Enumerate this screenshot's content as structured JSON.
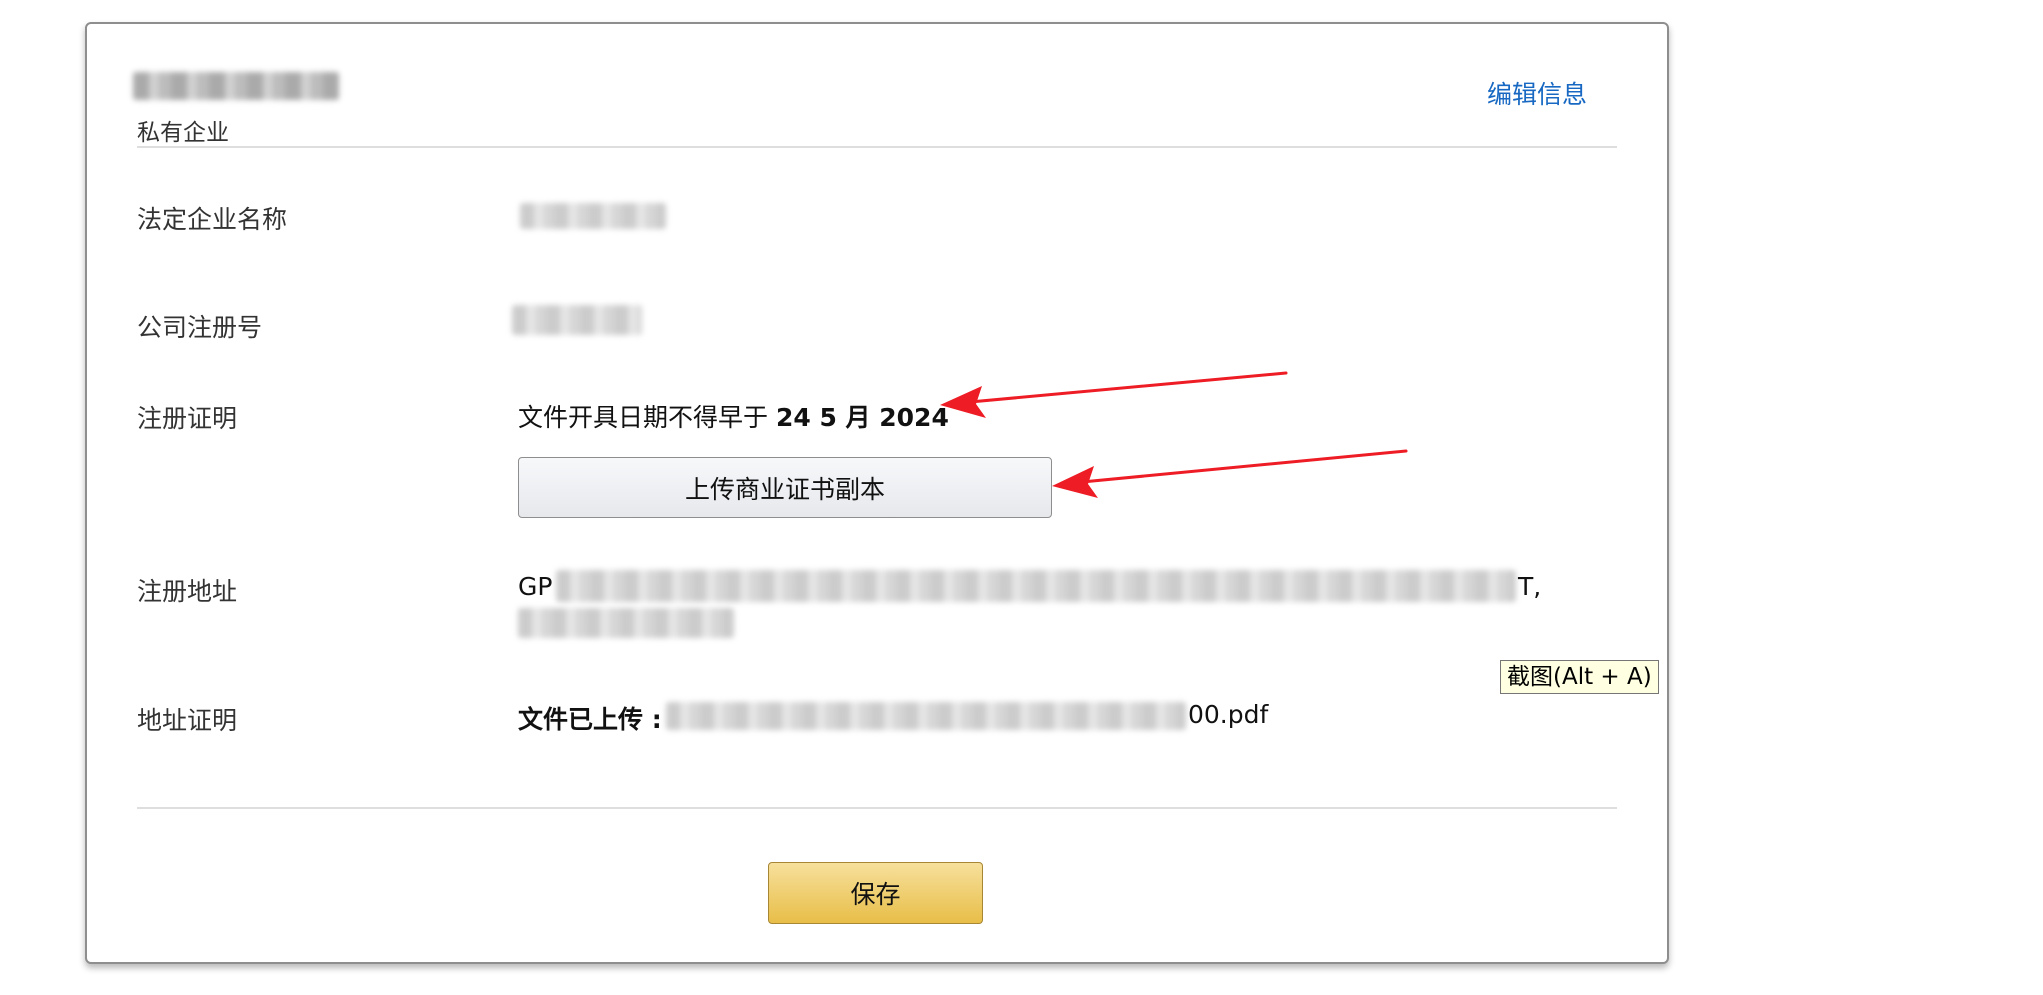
{
  "header": {
    "company_type": "私有企业",
    "edit_label": "编辑信息"
  },
  "fields": {
    "legal_name_label": "法定企业名称",
    "reg_number_label": "公司注册号",
    "reg_proof_label": "注册证明",
    "reg_proof_note": "文件开具日期不得早于",
    "reg_proof_date": "24 5 月 2024",
    "upload_button_label": "上传商业证书副本",
    "reg_address_label": "注册地址",
    "reg_address_prefix": "GP",
    "reg_address_suffix": "T,",
    "address_proof_label": "地址证明",
    "file_uploaded_label": "文件已上传 :",
    "file_name_visible": "00.pdf"
  },
  "footer": {
    "save_label": "保存"
  },
  "tooltip": {
    "screenshot_hint": "截图(Alt + A)"
  },
  "colors": {
    "link": "#1768c2",
    "annotation_arrow": "#ee1c24",
    "save_button": "#f0c14b",
    "tooltip_bg": "#ffffe1"
  }
}
